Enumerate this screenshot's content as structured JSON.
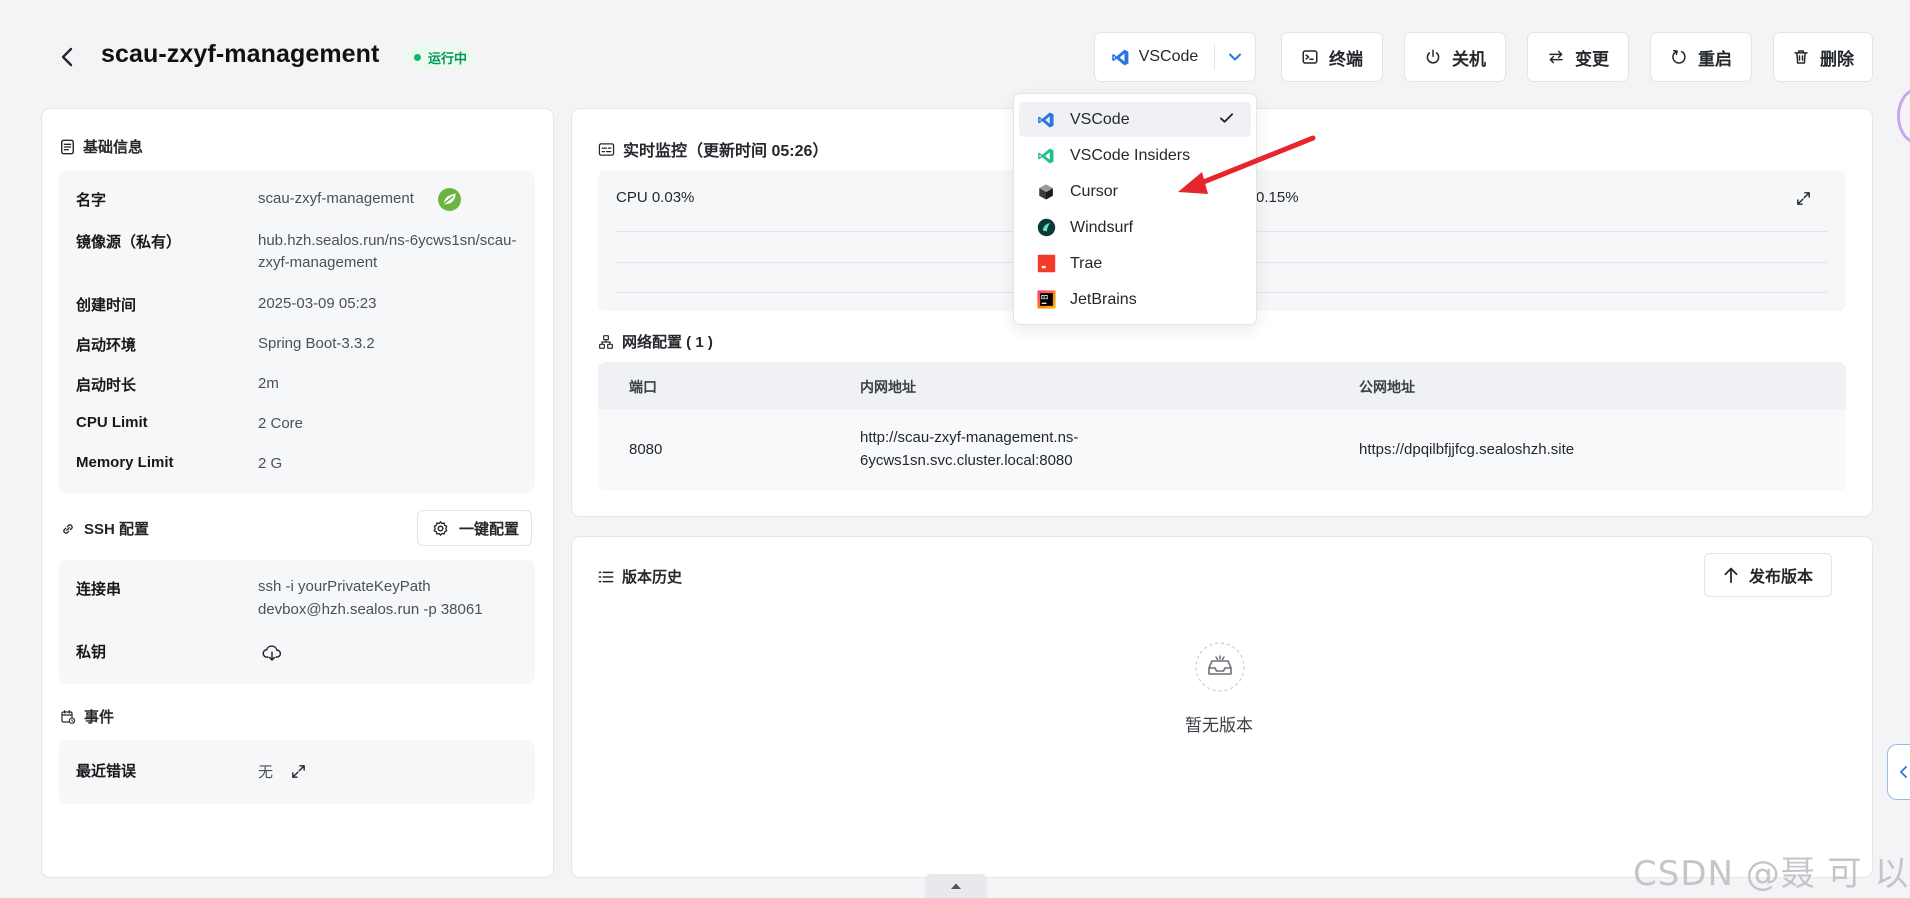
{
  "header": {
    "title": "scau-zxyf-management",
    "status": "运行中",
    "ide_selected": "VSCode",
    "actions": {
      "terminal": "终端",
      "shutdown": "关机",
      "change": "变更",
      "restart": "重启",
      "delete": "删除"
    }
  },
  "ide_menu": {
    "items": [
      {
        "label": "VSCode",
        "icon": "vscode-icon",
        "selected": true
      },
      {
        "label": "VSCode Insiders",
        "icon": "vscode-insiders-icon",
        "selected": false
      },
      {
        "label": "Cursor",
        "icon": "cursor-icon",
        "selected": false
      },
      {
        "label": "Windsurf",
        "icon": "windsurf-icon",
        "selected": false
      },
      {
        "label": "Trae",
        "icon": "trae-icon",
        "selected": false
      },
      {
        "label": "JetBrains",
        "icon": "jetbrains-icon",
        "selected": false
      }
    ]
  },
  "basic_info": {
    "title": "基础信息",
    "rows": [
      {
        "label": "名字",
        "value": "scau-zxyf-management"
      },
      {
        "label": "镜像源（私有）",
        "value": "hub.hzh.sealos.run/ns-6ycws1sn/scau-zxyf-management"
      },
      {
        "label": "创建时间",
        "value": "2025-03-09 05:23"
      },
      {
        "label": "启动环境",
        "value": "Spring Boot-3.3.2"
      },
      {
        "label": "启动时长",
        "value": "2m"
      },
      {
        "label": "CPU Limit",
        "value": "2 Core"
      },
      {
        "label": "Memory Limit",
        "value": "2 G"
      }
    ]
  },
  "ssh": {
    "title": "SSH 配置",
    "config_button": "一键配置",
    "conn_label": "连接串",
    "conn_line1": "ssh -i yourPrivateKeyPath",
    "conn_line2": "devbox@hzh.sealos.run -p 38061",
    "key_label": "私钥"
  },
  "events": {
    "title": "事件",
    "last_error_label": "最近错误",
    "last_error_value": "无"
  },
  "monitor": {
    "title": "实时监控（更新时间  05:26）",
    "cpu": "CPU 0.03%",
    "memory_partial": "0.15%"
  },
  "network": {
    "title": "网络配置 ( 1 )",
    "columns": [
      "端口",
      "内网地址",
      "公网地址"
    ],
    "rows": [
      {
        "port": "8080",
        "internal_line1": "http://scau-zxyf-management.ns-",
        "internal_line2": "6ycws1sn.svc.cluster.local:8080",
        "public": "https://dpqilbfjjfcg.sealoshzh.site"
      }
    ]
  },
  "versions": {
    "title": "版本历史",
    "publish_button": "发布版本",
    "empty_text": "暂无版本"
  },
  "watermark": "CSDN @聂 可 以",
  "colors": {
    "accent": "#2776e4",
    "status_green": "#039855",
    "arrow_red": "#e5272d"
  }
}
